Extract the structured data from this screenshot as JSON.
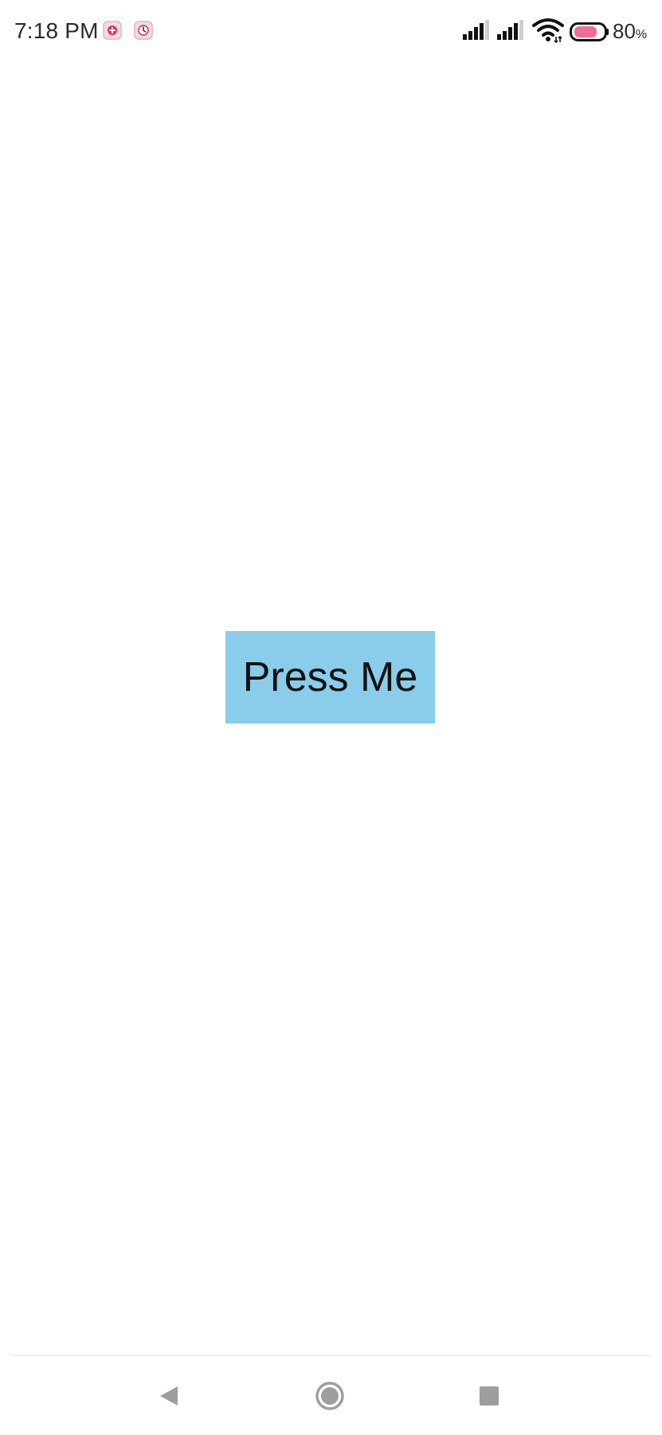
{
  "status_bar": {
    "time": "7:18 PM",
    "notification_icons": [
      "app-notification-icon",
      "app-notification-icon"
    ],
    "battery_level": "80",
    "battery_unit": "%",
    "battery_fraction": 0.8,
    "battery_color": "#f06e95"
  },
  "main": {
    "button_label": "Press Me",
    "button_color": "#89cdea"
  },
  "nav_bar": {
    "buttons": [
      "back-icon",
      "home-icon",
      "recents-icon"
    ]
  }
}
